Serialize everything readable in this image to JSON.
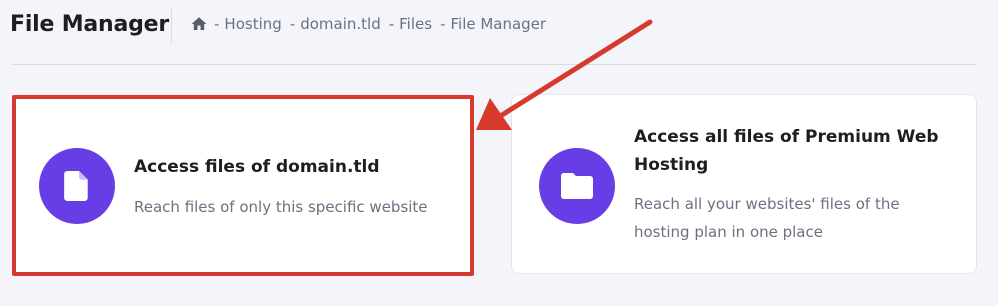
{
  "header": {
    "title": "File Manager",
    "breadcrumb": [
      "Hosting",
      "domain.tld",
      "Files",
      "File Manager"
    ],
    "separator": "-"
  },
  "cards": [
    {
      "title": "Access files of domain.tld",
      "description": "Reach files of only this specific website",
      "icon": "file-icon",
      "highlighted": true
    },
    {
      "title": "Access all files of Premium Web Hosting",
      "description": "Reach all your websites' files of the hosting plan in one place",
      "icon": "folder-icon",
      "highlighted": false
    }
  ],
  "colors": {
    "accent": "#673de6",
    "highlight": "#d63a2f",
    "background": "#f4f4fb"
  }
}
